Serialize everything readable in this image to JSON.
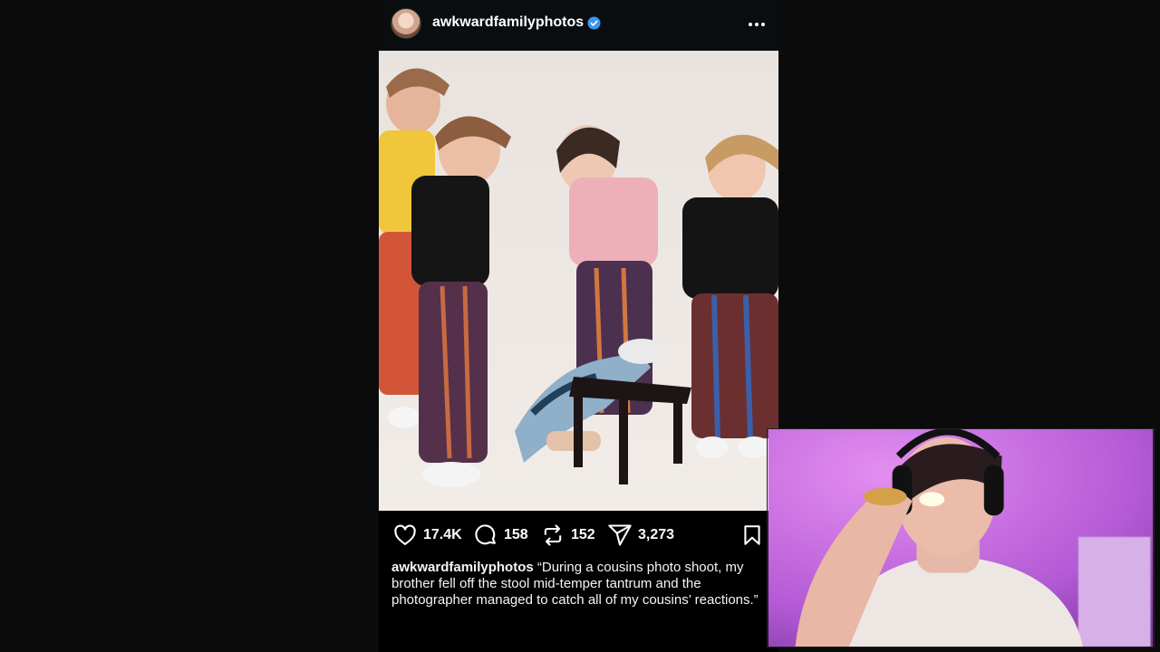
{
  "post": {
    "username": "awkwardfamilyphotos",
    "verified": true,
    "menu_icon": "more-horizontal-icon",
    "actions": {
      "likes": "17.4K",
      "comments": "158",
      "reposts": "152",
      "shares": "3,273"
    },
    "caption": {
      "username": "awkwardfamilyphotos",
      "text": "“During a cousins photo shoot, my brother fell off the stool mid-temper tantrum and the photographer managed to catch all of my cousins’ reactions.”"
    }
  },
  "colors": {
    "background": "#0b0b0b",
    "verified_blue": "#3897f0",
    "webcam_purple": "#b45ad6"
  }
}
